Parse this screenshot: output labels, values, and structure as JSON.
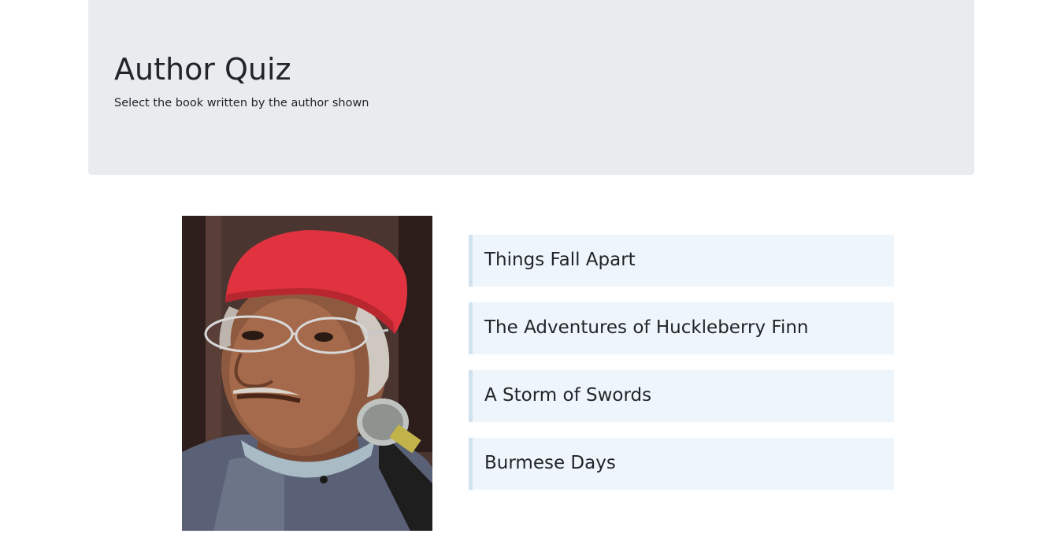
{
  "header": {
    "title": "Author Quiz",
    "subtitle": "Select the book written by the author shown"
  },
  "author": {
    "image": "author-portrait"
  },
  "answers": [
    {
      "label": "Things Fall Apart"
    },
    {
      "label": "The Adventures of Huckleberry Finn"
    },
    {
      "label": "A Storm of Swords"
    },
    {
      "label": "Burmese Days"
    }
  ],
  "colors": {
    "jumbotron_bg": "#e9ecef",
    "answer_bg": "#eef6fc",
    "answer_border": "#cfe2ee",
    "text": "#212529"
  }
}
